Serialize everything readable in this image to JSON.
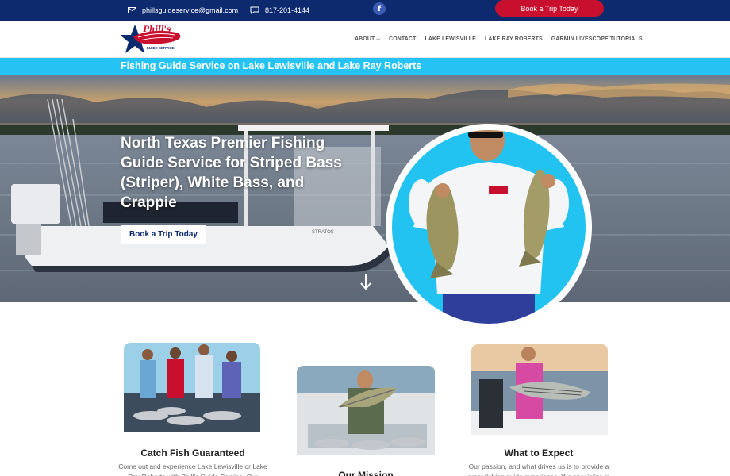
{
  "topbar": {
    "email": "phillsguideservice@gmail.com",
    "phone": "817-201-4144",
    "facebook_glyph": "f",
    "book_label": "Book a Trip Today",
    "colors": {
      "bar": "#0d2a6e",
      "button": "#c8102e"
    }
  },
  "header": {
    "logo": {
      "script": "Phill's",
      "sub": "GUIDE SERVICE"
    },
    "nav": [
      {
        "label": "ABOUT"
      },
      {
        "label": "CONTACT"
      },
      {
        "label": "LAKE LEWISVILLE"
      },
      {
        "label": "LAKE RAY ROBERTS"
      },
      {
        "label": "GARMIN LIVESCOPE TUTORIALS"
      }
    ]
  },
  "tagline": "Fishing Guide Service on Lake Lewisville and Lake Ray Roberts",
  "hero": {
    "title": "North Texas Premier Fishing Guide Service for Striped Bass (Striper), White Bass, and Crappie",
    "button": "Book a Trip Today",
    "boat_name": "STRATOS"
  },
  "features": [
    {
      "title": "Catch Fish Guaranteed",
      "text": "Come out and experience Lake Lewisville or Lake Ray Roberts with Phill's Guide Service. Our"
    },
    {
      "title": "Our Mission",
      "text": ""
    },
    {
      "title": "What to Expect",
      "text": "Our passion, and what drives us is to provide a great fishing guide experience. We specialize in"
    }
  ],
  "icons": [
    "envelope-icon",
    "chat-icon",
    "facebook-icon",
    "chevron-down-icon",
    "arrow-down-icon"
  ],
  "colors": {
    "accent": "#25c3f3",
    "navy": "#0d2a6e",
    "red": "#c8102e"
  }
}
